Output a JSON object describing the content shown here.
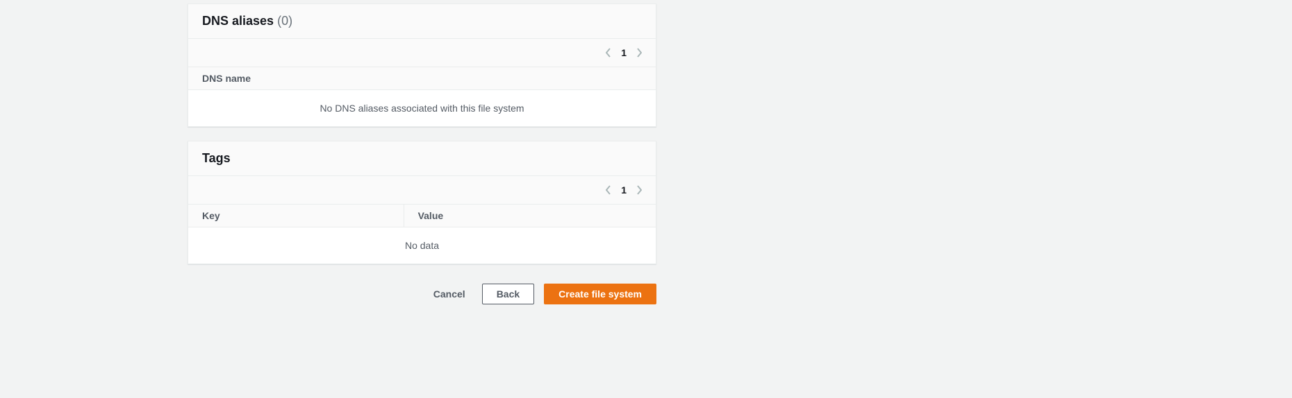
{
  "dns_aliases": {
    "title": "DNS aliases",
    "count": "(0)",
    "page": "1",
    "column_dns_name": "DNS name",
    "empty_message": "No DNS aliases associated with this file system"
  },
  "tags": {
    "title": "Tags",
    "page": "1",
    "column_key": "Key",
    "column_value": "Value",
    "empty_message": "No data"
  },
  "footer": {
    "cancel": "Cancel",
    "back": "Back",
    "create": "Create file system"
  }
}
